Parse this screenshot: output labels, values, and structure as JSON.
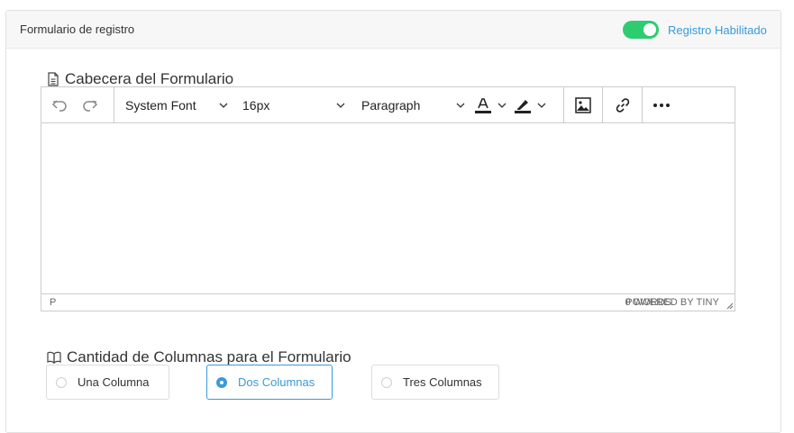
{
  "panel": {
    "title": "Formulario de registro",
    "toggle_label": "Registro Habilitado",
    "toggle_on": true,
    "accent_color": "#3a9ad9",
    "toggle_color": "#2ecc71"
  },
  "header_section": {
    "label": "Cabecera del Formulario",
    "icon": "document-icon"
  },
  "editor": {
    "toolbar": {
      "undo_icon": "undo-icon",
      "redo_icon": "redo-icon",
      "font_family": "System Font",
      "font_size": "16px",
      "block_format": "Paragraph",
      "text_color_icon": "text-color-icon",
      "highlight_icon": "highlight-icon",
      "image_icon": "image-icon",
      "link_icon": "link-icon",
      "more_icon": "more-icon"
    },
    "status": {
      "path": "P",
      "words": "0 WORDS",
      "powered": "POWERED BY TINY"
    }
  },
  "columns_section": {
    "label": "Cantidad de Columnas para el Formulario",
    "icon": "book-icon",
    "options": [
      {
        "label": "Una Columna",
        "selected": false
      },
      {
        "label": "Dos Columnas",
        "selected": true
      },
      {
        "label": "Tres Columnas",
        "selected": false
      }
    ]
  }
}
